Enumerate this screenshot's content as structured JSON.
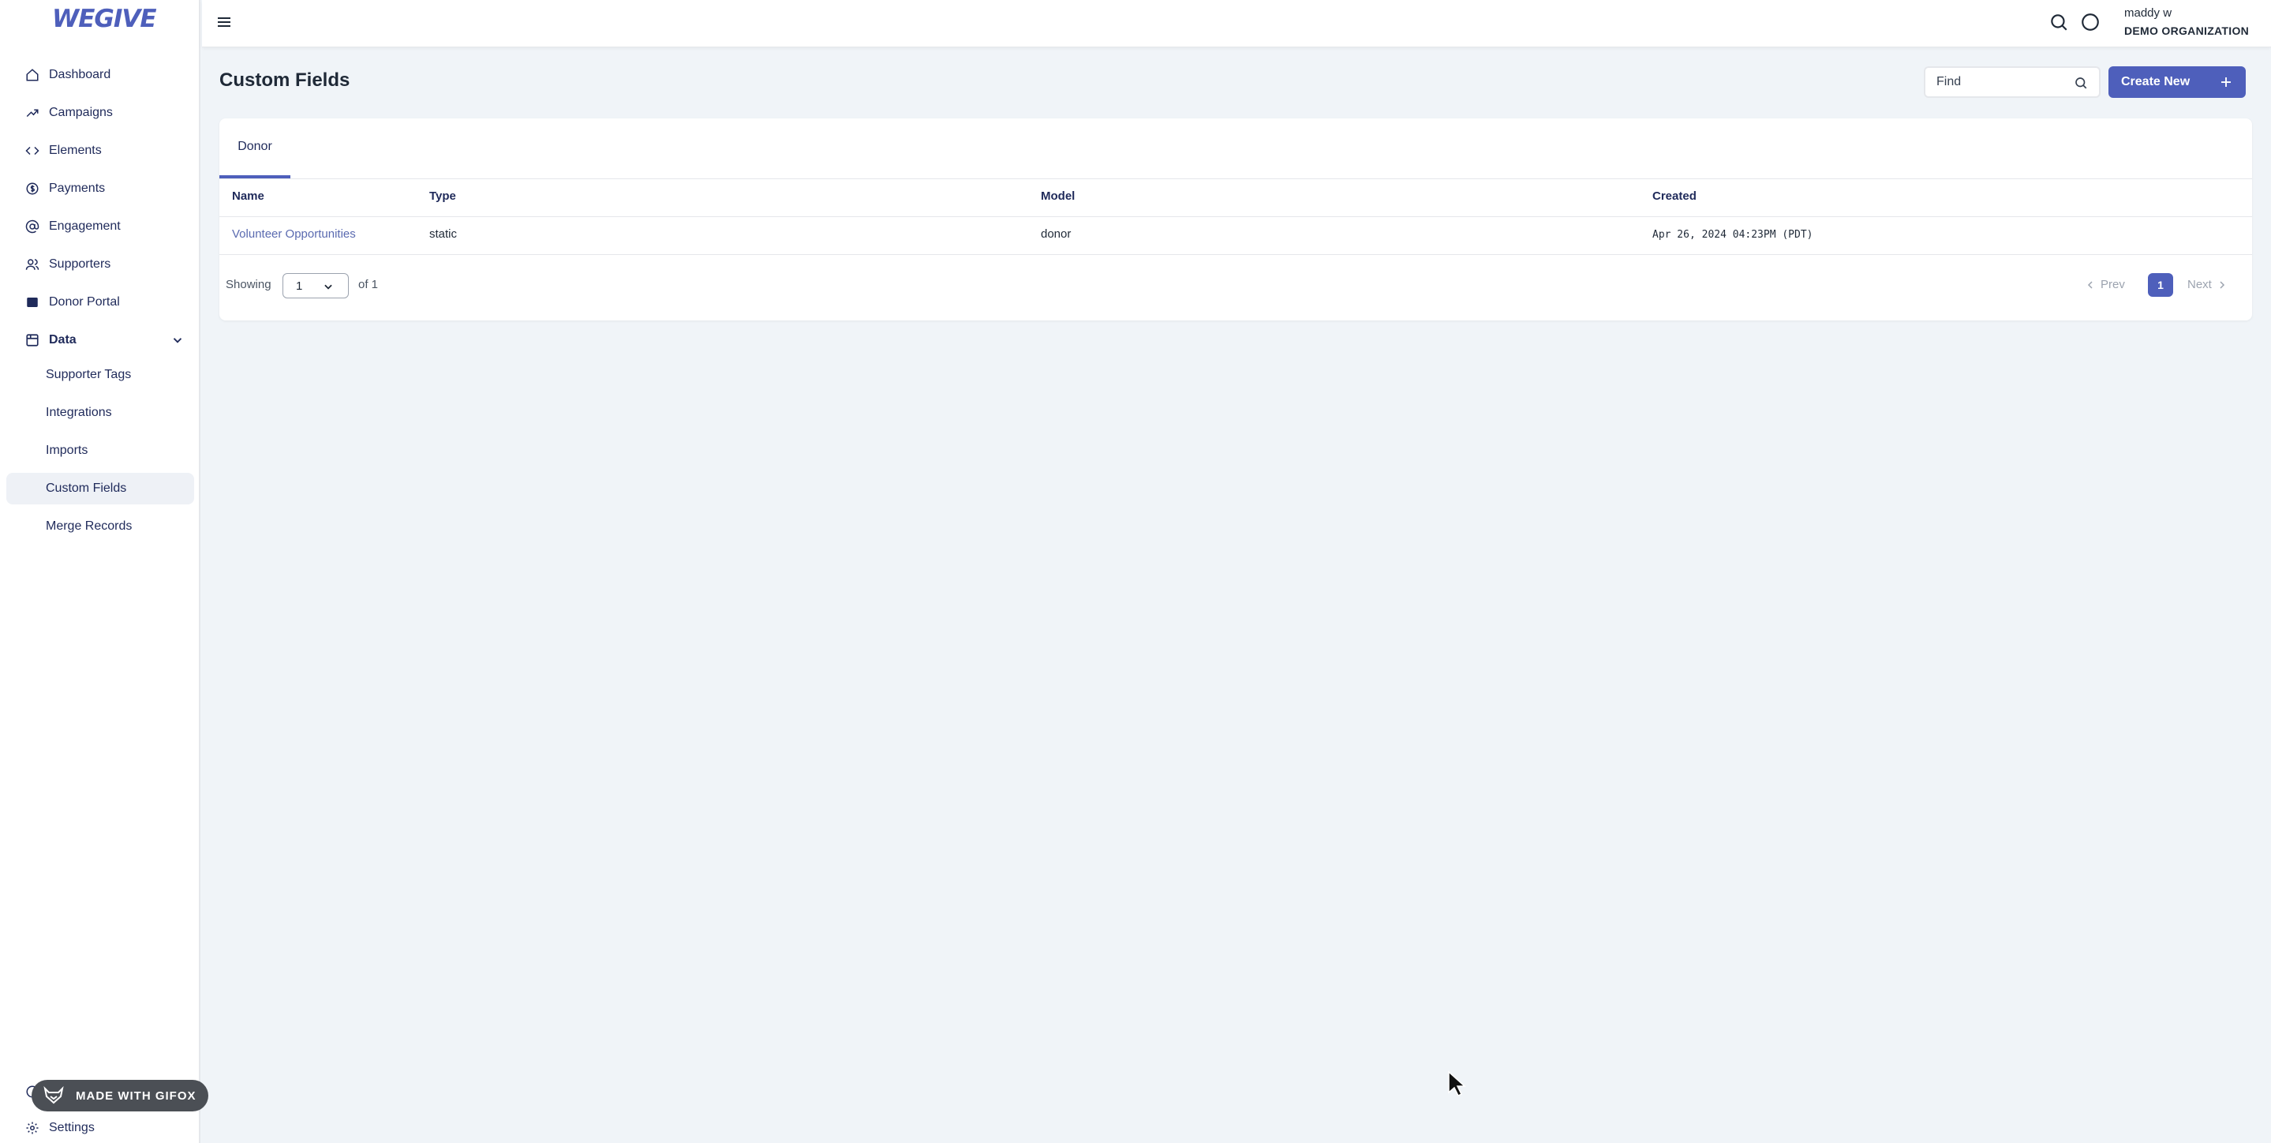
{
  "brand": {
    "logo_text": "WEGIVE",
    "accent": "#4e5fbb"
  },
  "sidebar": {
    "items": [
      {
        "label": "Dashboard",
        "icon": "home-icon"
      },
      {
        "label": "Campaigns",
        "icon": "trending-up-icon"
      },
      {
        "label": "Elements",
        "icon": "code-icon"
      },
      {
        "label": "Payments",
        "icon": "dollar-circle-icon"
      },
      {
        "label": "Engagement",
        "icon": "at-sign-icon"
      },
      {
        "label": "Supporters",
        "icon": "users-icon"
      },
      {
        "label": "Donor Portal",
        "icon": "card-icon"
      },
      {
        "label": "Data",
        "icon": "database-icon",
        "expanded": true
      }
    ],
    "data_subitems": [
      {
        "label": "Supporter Tags"
      },
      {
        "label": "Integrations"
      },
      {
        "label": "Imports"
      },
      {
        "label": "Custom Fields",
        "active": true
      },
      {
        "label": "Merge Records"
      }
    ],
    "settings_label": "Settings"
  },
  "gifox_badge": "MADE WITH GIFOX",
  "user": {
    "name": "maddy w",
    "org": "DEMO ORGANIZATION"
  },
  "page": {
    "title": "Custom Fields",
    "find_placeholder": "Find",
    "create_label": "Create New"
  },
  "tabs": [
    {
      "label": "Donor",
      "active": true
    }
  ],
  "table": {
    "columns": [
      "Name",
      "Type",
      "Model",
      "Created"
    ],
    "rows": [
      {
        "name": "Volunteer Opportunities",
        "type": "static",
        "model": "donor",
        "created": "Apr 26, 2024 04:23PM (PDT)"
      }
    ]
  },
  "pagination": {
    "showing_label": "Showing",
    "current": "1",
    "of_label": "of 1",
    "prev_label": "Prev",
    "next_label": "Next",
    "page_button": "1"
  }
}
